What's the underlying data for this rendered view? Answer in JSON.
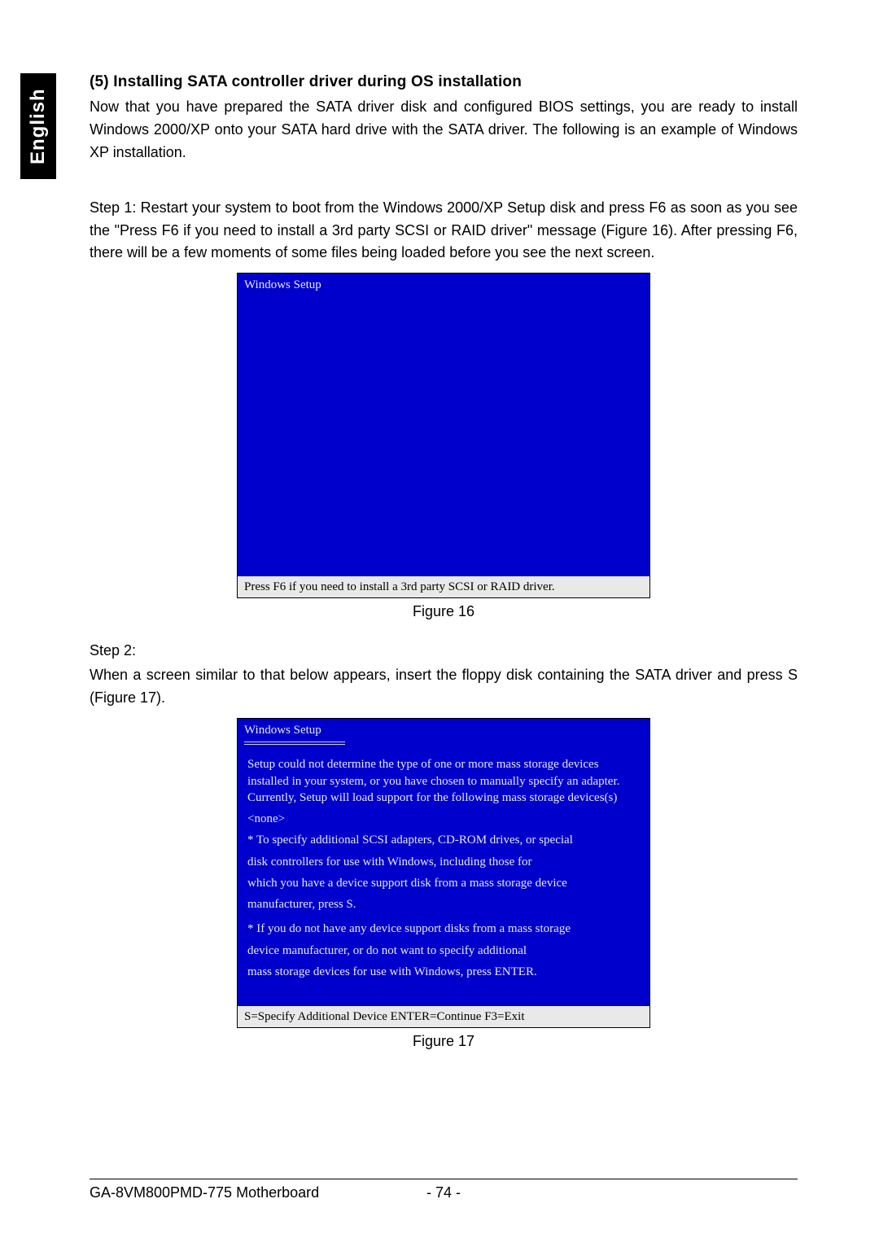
{
  "sideTab": "English",
  "section": {
    "heading": "(5)  Installing SATA controller driver during OS installation",
    "intro": "Now that you have prepared the SATA driver disk and configured BIOS settings, you are ready to install Windows 2000/XP onto your SATA hard drive with the SATA driver. The following is an example of Windows XP installation.",
    "step1": "Step 1: Restart your system to boot from the Windows 2000/XP Setup disk and press F6 as soon as you see the \"Press F6 if you need to install a 3rd party SCSI or RAID driver\" message (Figure 16).  After pressing F6, there will be a few moments of some files being loaded before you see the next screen.",
    "step2_label": "Step 2:",
    "step2_text": "When a screen similar to that below appears, insert the floppy disk containing the SATA driver and press S (Figure 17)."
  },
  "figure16": {
    "title": "Windows Setup",
    "status": "Press F6 if you need to install  a 3rd party SCSI or RAID driver.",
    "caption": "Figure 16"
  },
  "figure17": {
    "title": "Windows Setup",
    "body_p1": "Setup could not determine the type of one or more mass storage devices installed in your system, or you have chosen to manually specify an adapter. Currently, Setup will load support for the following mass storage devices(s)",
    "none": "<none>",
    "bullet1_l1": "* To specify additional SCSI adapters, CD-ROM drives, or special",
    "bullet1_l2": "disk  controllers for use with Windows, including those for",
    "bullet1_l3": "which you have a device support disk from a mass storage device",
    "bullet1_l4": "manufacturer, press S.",
    "bullet2_l1": "* If you do not have any device support disks from a mass storage",
    "bullet2_l2": "device manufacturer, or do not want to specify additional",
    "bullet2_l3": "mass storage devices for use with Windows, press ENTER.",
    "status": "S=Specify Additional Device   ENTER=Continue   F3=Exit",
    "caption": "Figure 17"
  },
  "footer": {
    "left": "GA-8VM800PMD-775 Motherboard",
    "page": "- 74 -"
  }
}
